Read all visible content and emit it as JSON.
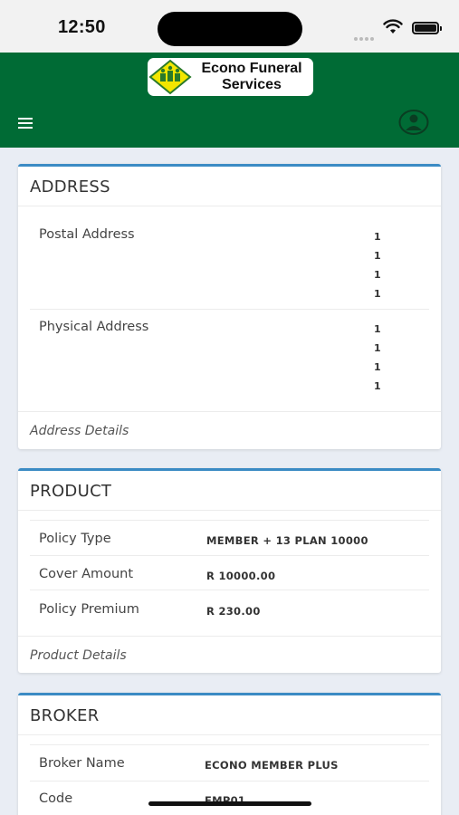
{
  "status_bar": {
    "time": "12:50"
  },
  "header": {
    "logo_line1": "Econo Funeral",
    "logo_line2": "Services",
    "colors": {
      "header_bg": "#006b35",
      "accent": "#3b8bc4"
    },
    "icons": [
      "menu-icon",
      "user-avatar-icon"
    ]
  },
  "address": {
    "title": "ADDRESS",
    "postal_label": "Postal Address",
    "postal_lines": [
      "1",
      "1",
      "1",
      "1"
    ],
    "physical_label": "Physical Address",
    "physical_lines": [
      "1",
      "1",
      "1",
      "1"
    ],
    "footer": "Address Details"
  },
  "product": {
    "title": "PRODUCT",
    "rows": [
      {
        "label": "Policy Type",
        "value": "MEMBER + 13 PLAN 10000"
      },
      {
        "label": "Cover Amount",
        "value": "R 10000.00"
      },
      {
        "label": "Policy Premium",
        "value": "R 230.00"
      }
    ],
    "footer": "Product Details"
  },
  "broker": {
    "title": "BROKER",
    "rows": [
      {
        "label": "Broker Name",
        "value": "ECONO MEMBER PLUS"
      },
      {
        "label": "Code",
        "value": "EMP01"
      }
    ]
  }
}
